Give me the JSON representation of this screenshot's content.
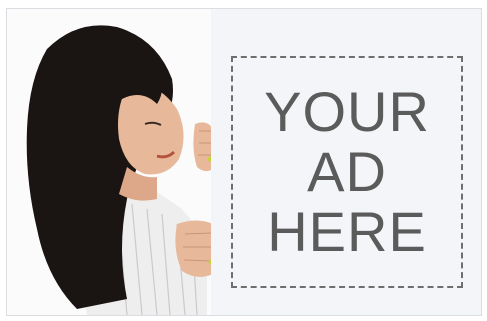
{
  "ad": {
    "lines": [
      "YOUR",
      "AD",
      "HERE"
    ]
  },
  "colors": {
    "board": "#f4f5f8",
    "text": "#5b5b5b",
    "dash": "#6e6e6e",
    "hair": "#1a1412",
    "skin": "#e7b99a"
  },
  "photo": {
    "subject": "woman-peeking-behind-board"
  }
}
